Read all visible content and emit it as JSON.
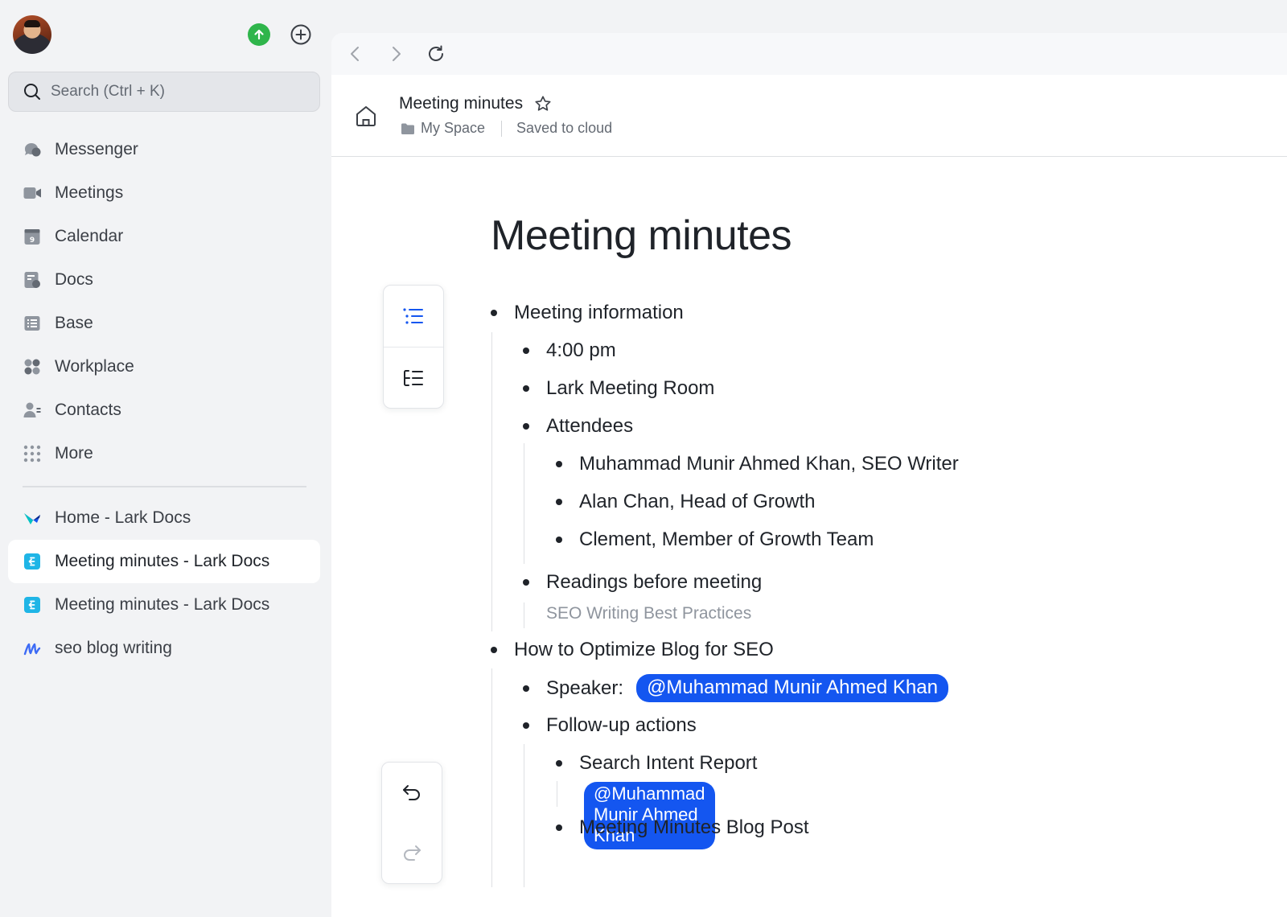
{
  "sidebar": {
    "search_placeholder": "Search (Ctrl + K)",
    "nav": [
      {
        "label": "Messenger",
        "icon": "messenger-icon"
      },
      {
        "label": "Meetings",
        "icon": "video-camera-icon"
      },
      {
        "label": "Calendar",
        "icon": "calendar-icon",
        "badge": "9"
      },
      {
        "label": "Docs",
        "icon": "docs-icon"
      },
      {
        "label": "Base",
        "icon": "base-table-icon"
      },
      {
        "label": "Workplace",
        "icon": "workplace-grid-icon"
      },
      {
        "label": "Contacts",
        "icon": "contacts-icon"
      },
      {
        "label": "More",
        "icon": "more-dots-icon"
      }
    ],
    "recent": [
      {
        "label": "Home - Lark Docs",
        "icon": "lark-logo-icon",
        "active": false
      },
      {
        "label": "Meeting minutes - Lark Docs",
        "icon": "doc-file-icon",
        "active": true
      },
      {
        "label": "Meeting minutes - Lark Docs",
        "icon": "doc-file-icon",
        "active": false
      },
      {
        "label": "seo blog writing",
        "icon": "handwriting-doc-icon",
        "active": false
      }
    ]
  },
  "header": {
    "doc_title": "Meeting minutes",
    "location": "My Space",
    "save_status": "Saved to cloud"
  },
  "document": {
    "title": "Meeting minutes",
    "outline": {
      "meeting_info": "Meeting information",
      "time": "4:00 pm",
      "room": "Lark Meeting Room",
      "attendees": "Attendees",
      "attendee_list": [
        "Muhammad Munir Ahmed Khan, SEO Writer",
        "Alan Chan, Head of Growth",
        "Clement, Member of Growth Team"
      ],
      "readings": "Readings before meeting",
      "readings_note": "SEO Writing Best Practices",
      "topic": "How to Optimize Blog for SEO",
      "speaker_label": "Speaker:",
      "speaker_mention": "@Muhammad Munir Ahmed Khan",
      "followup": "Follow-up actions",
      "action_1": "Search Intent Report",
      "action_1_mention": "@Muhammad Munir Ahmed Khan",
      "action_2": "Meeting Minutes Blog Post"
    }
  },
  "colors": {
    "accent": "#1456f0",
    "upload_green": "#2fb54b",
    "doc_icon_teal": "#1fb5e6"
  }
}
